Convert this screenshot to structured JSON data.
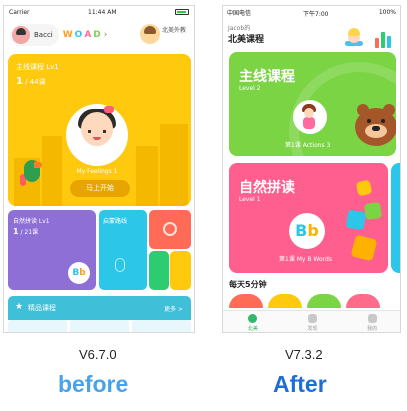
{
  "before": {
    "status": {
      "carrier": "Carrier",
      "time": "11:44 AM"
    },
    "header": {
      "username": "Bacci",
      "wordlogo": [
        "W",
        "O",
        "A",
        "D"
      ],
      "teacher_label": "北美外教"
    },
    "main_card": {
      "title": "主线课程 Lv1",
      "progress_num": "1",
      "progress_total": " / 44课",
      "lesson_label": "My Feelings 1",
      "start_button": "马上开始",
      "color": "#ffc90e"
    },
    "natural_card": {
      "title": "自然拼读 Lv1",
      "progress_num": "1",
      "progress_total": " / 21课",
      "logo_b": "B",
      "logo_b2": "b"
    },
    "small_card": {
      "title": "启蒙路线"
    },
    "featured": {
      "title": "精品课程",
      "more": "更多 >"
    },
    "version": "V6.7.0",
    "caption": "before"
  },
  "after": {
    "status": {
      "carrier": "中国电信",
      "time": "下午7:00",
      "battery": "100%"
    },
    "header": {
      "user": "Jacob的",
      "title": "北美课程"
    },
    "main_card": {
      "title": "主线课程",
      "level": "Level 2",
      "lesson_num": "第1课",
      "lesson_name": "Actions 3",
      "color": "#7bd444"
    },
    "natural_card": {
      "title": "自然拼读",
      "level": "Level 1",
      "lesson_num": "第1课",
      "lesson_name": "My B Words",
      "logo_b": "B",
      "logo_b2": "b",
      "color": "#ff5f8f"
    },
    "daily": {
      "title": "每天5分钟"
    },
    "tabs": [
      {
        "label": "北美",
        "active": true
      },
      {
        "label": "发现",
        "active": false
      },
      {
        "label": "我的",
        "active": false
      }
    ],
    "version": "V7.3.2",
    "caption": "After"
  }
}
